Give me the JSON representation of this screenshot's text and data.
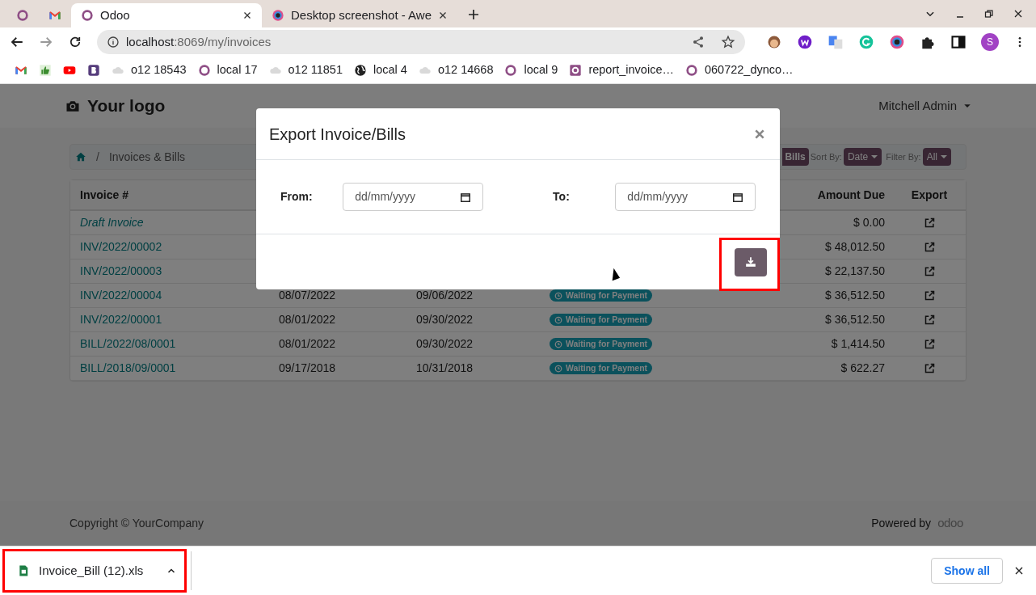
{
  "browser": {
    "tabs": [
      {
        "kind": "odoo",
        "selected": false
      },
      {
        "kind": "gmail",
        "selected": false
      },
      {
        "kind": "odoo",
        "title": "Odoo",
        "selected": true
      },
      {
        "kind": "camera",
        "title": "Desktop screenshot - Awe",
        "selected": false
      }
    ],
    "url": {
      "host": "localhost",
      "path": ":8069/my/invoices"
    },
    "profile": "S",
    "bookmarks": [
      {
        "kind": "gmail"
      },
      {
        "kind": "thumb"
      },
      {
        "kind": "youtube"
      },
      {
        "kind": "bootstrap"
      },
      {
        "kind": "cloud",
        "label": "o12 18543"
      },
      {
        "kind": "odoo",
        "label": "local 17"
      },
      {
        "kind": "cloud",
        "label": "o12 11851"
      },
      {
        "kind": "globe",
        "label": "local 4"
      },
      {
        "kind": "cloud",
        "label": "o12 14668"
      },
      {
        "kind": "odoo",
        "label": "local 9"
      },
      {
        "kind": "odoo-square",
        "label": "report_invoice…"
      },
      {
        "kind": "odoo",
        "label": "060722_dynco…"
      }
    ]
  },
  "page": {
    "logo": "Your logo",
    "user": "Mitchell Admin",
    "breadcrumb_separator": "/",
    "breadcrumb": "Invoices & Bills",
    "toolbar": {
      "partial_button": "Bills",
      "sort_label": "Sort By:",
      "sort_value": "Date",
      "filter_label": "Filter By:",
      "filter_value": "All"
    },
    "table": {
      "columns": [
        "Invoice #",
        "Amount Due",
        "Export"
      ],
      "rows": [
        {
          "invoice": "Draft Invoice",
          "draft": true,
          "amount": "$ 0.00"
        },
        {
          "invoice": "INV/2022/00002",
          "draft": false,
          "amount": "$ 48,012.50"
        },
        {
          "invoice": "INV/2022/00003",
          "draft": false,
          "amount": "$ 22,137.50"
        },
        {
          "invoice": "INV/2022/00004",
          "draft": false,
          "date": "08/07/2022",
          "due": "09/06/2022",
          "status": "Waiting for Payment",
          "amount": "$ 36,512.50"
        },
        {
          "invoice": "INV/2022/00001",
          "draft": false,
          "date": "08/01/2022",
          "due": "09/30/2022",
          "status": "Waiting for Payment",
          "amount": "$ 36,512.50"
        },
        {
          "invoice": "BILL/2022/08/0001",
          "draft": false,
          "date": "08/01/2022",
          "due": "09/30/2022",
          "status": "Waiting for Payment",
          "amount": "$ 1,414.50"
        },
        {
          "invoice": "BILL/2018/09/0001",
          "draft": false,
          "date": "09/17/2018",
          "due": "10/31/2018",
          "status": "Waiting for Payment",
          "amount": "$ 622.27"
        }
      ]
    },
    "footer": {
      "copyright": "Copyright © YourCompany",
      "powered": "Powered by",
      "brand": "odoo"
    }
  },
  "modal": {
    "title": "Export Invoice/Bills",
    "from_label": "From:",
    "from_placeholder": "dd/mm/yyyy",
    "to_label": "To:",
    "to_placeholder": "dd/mm/yyyy"
  },
  "downloads": {
    "file": "Invoice_Bill (12).xls",
    "show_all": "Show all"
  }
}
